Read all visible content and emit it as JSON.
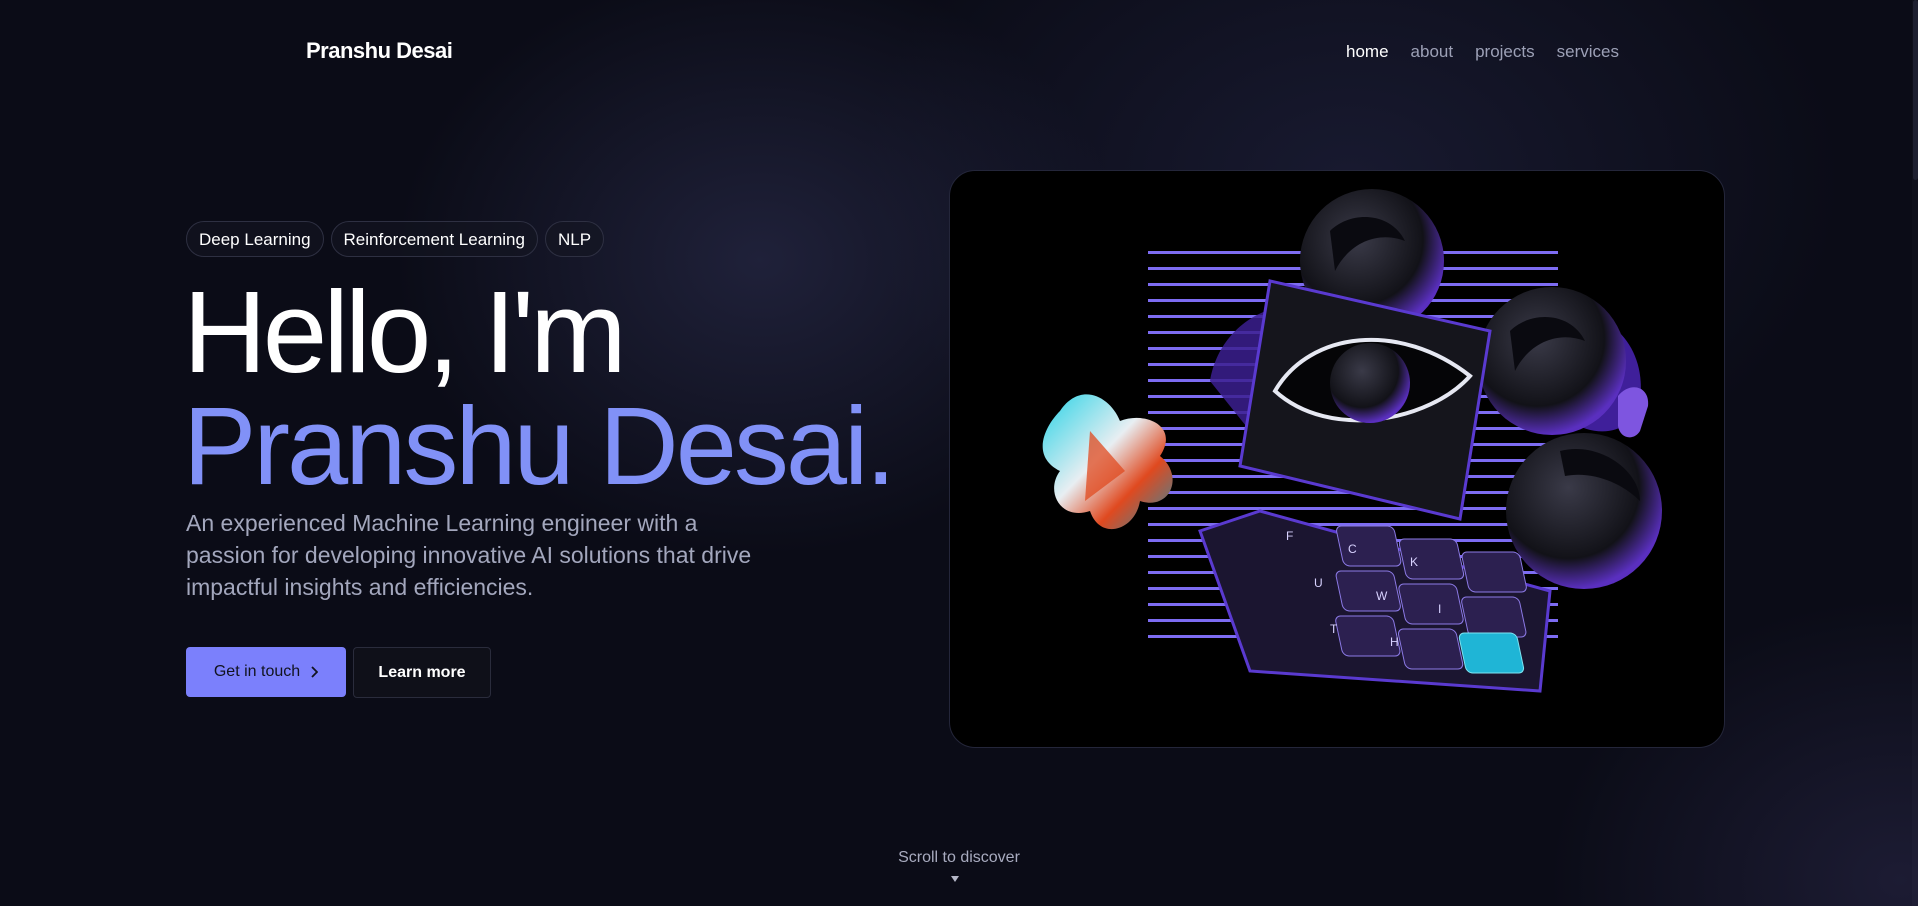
{
  "header": {
    "brand": "Pranshu Desai",
    "nav": [
      {
        "label": "home",
        "active": true
      },
      {
        "label": "about",
        "active": false
      },
      {
        "label": "projects",
        "active": false
      },
      {
        "label": "services",
        "active": false
      }
    ]
  },
  "hero": {
    "tags": [
      "Deep Learning",
      "Reinforcement Learning",
      "NLP"
    ],
    "greeting": "Hello, I'm",
    "name": "Pranshu Desai.",
    "description": "An experienced Machine Learning engineer with a passion for developing innovative AI solutions that drive impactful insights and efficiencies.",
    "primary_button": "Get in touch",
    "secondary_button": "Learn more",
    "image_keys": [
      "F",
      "C",
      "K",
      "U",
      "W",
      "I",
      "T",
      "H"
    ]
  },
  "scroll_hint": "Scroll to discover",
  "colors": {
    "background": "#0b0c17",
    "accent": "#8191f7",
    "button": "#7b80fc",
    "muted_text": "#a3a7bd"
  },
  "icons": {
    "primary_button_icon": "chevron-right-icon",
    "scroll_icon": "caret-down-icon"
  }
}
